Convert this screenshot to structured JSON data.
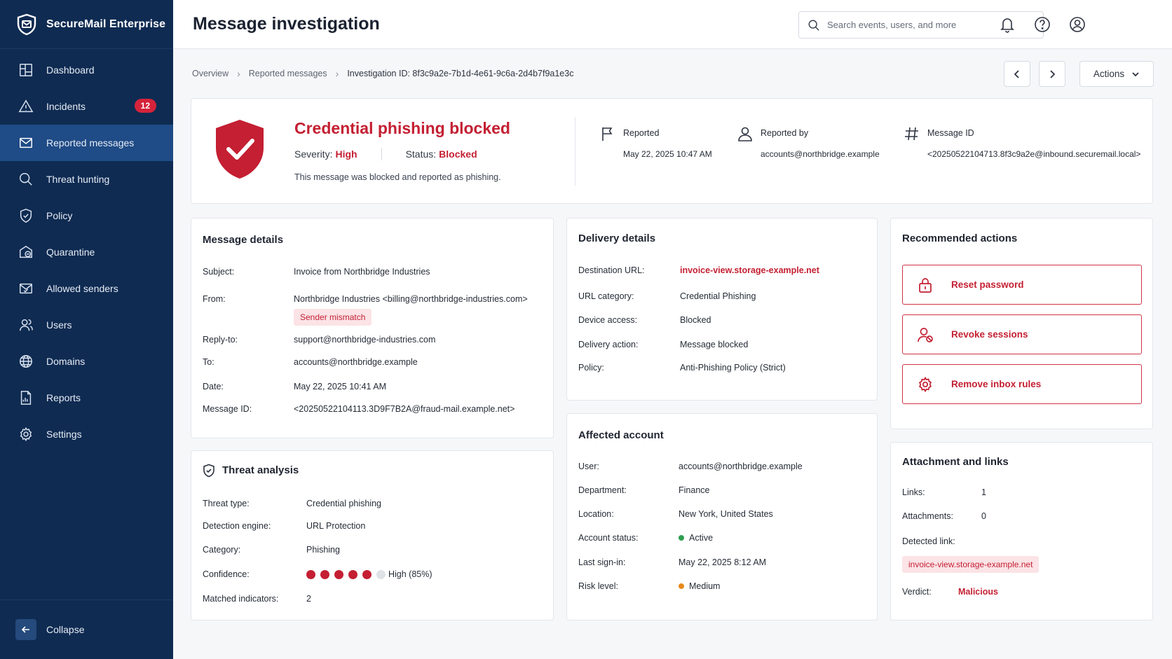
{
  "app": {
    "name": "SecureMail Enterprise"
  },
  "sidebar": {
    "items": [
      {
        "label": "Dashboard",
        "icon": "dashboard-icon"
      },
      {
        "label": "Incidents",
        "icon": "warning-icon",
        "badge": "12"
      },
      {
        "label": "Reported messages",
        "icon": "mail-icon",
        "active": true
      },
      {
        "label": "Threat hunting",
        "icon": "search-icon"
      },
      {
        "label": "Policy",
        "icon": "shield-icon"
      },
      {
        "label": "Quarantine",
        "icon": "quarantine-icon"
      },
      {
        "label": "Allowed senders",
        "icon": "mail-check-icon"
      },
      {
        "label": "Users",
        "icon": "users-icon"
      },
      {
        "label": "Domains",
        "icon": "globe-icon"
      },
      {
        "label": "Reports",
        "icon": "report-icon"
      },
      {
        "label": "Settings",
        "icon": "gear-icon"
      }
    ],
    "collapse_label": "Collapse"
  },
  "header": {
    "title": "Message investigation",
    "search_placeholder": "Search events, users, and more"
  },
  "breadcrumb": {
    "items": [
      "Overview",
      "Reported messages"
    ],
    "current": "Investigation ID: 8f3c9a2e-7b1d-4e61-9c6a-2d4b7f9a1e3c"
  },
  "toolbar": {
    "actions_label": "Actions"
  },
  "summary": {
    "title": "Credential phishing blocked",
    "severity_label": "Severity:",
    "severity": "High",
    "status_label": "Status:",
    "status": "Blocked",
    "description": "This message was blocked and reported as phishing.",
    "reported_label": "Reported",
    "reported_value": "May 22, 2025 10:47 AM",
    "reported_by_label": "Reported by",
    "reported_by_value": "accounts@northbridge.example",
    "message_id_label": "Message ID",
    "message_id_value": "<20250522104713.8f3c9a2e@inbound.securemail.local>"
  },
  "message_details": {
    "title": "Message details",
    "subject_label": "Subject:",
    "subject": "Invoice from Northbridge Industries",
    "from_label": "From:",
    "from": "Northbridge Industries <billing@northbridge-industries.com>",
    "sender_flag": "Sender mismatch",
    "reply_to_label": "Reply-to:",
    "reply_to": "support@northbridge-industries.com",
    "to_label": "To:",
    "to": "accounts@northbridge.example",
    "date_label": "Date:",
    "date": "May 22, 2025 10:41 AM",
    "message_id_label": "Message ID:",
    "message_id": "<20250522104113.3D9F7B2A@fraud-mail.example.net>"
  },
  "threat_analysis": {
    "title": "Threat analysis",
    "threat_type_label": "Threat type:",
    "threat_type": "Credential phishing",
    "engine_label": "Detection engine:",
    "engine": "URL Protection",
    "category_label": "Category:",
    "category": "Phishing",
    "confidence_label": "Confidence:",
    "confidence_filled": 5,
    "confidence_total": 6,
    "confidence_text": "High (85%)",
    "indicators_label": "Matched indicators:",
    "indicators": "2"
  },
  "delivery_details": {
    "title": "Delivery details",
    "dest_url_label": "Destination URL:",
    "dest_url": "invoice-view.storage-example.net",
    "url_category_label": "URL category:",
    "url_category": "Credential Phishing",
    "device_access_label": "Device access:",
    "device_access": "Blocked",
    "delivery_action_label": "Delivery action:",
    "delivery_action": "Message blocked",
    "policy_label": "Policy:",
    "policy": "Anti-Phishing Policy (Strict)"
  },
  "affected_account": {
    "title": "Affected account",
    "user_label": "User:",
    "user": "accounts@northbridge.example",
    "department_label": "Department:",
    "department": "Finance",
    "location_label": "Location:",
    "location": "New York, United States",
    "status_label": "Account status:",
    "status": "Active",
    "last_signin_label": "Last sign-in:",
    "last_signin": "May 22, 2025 8:12 AM",
    "risk_label": "Risk level:",
    "risk": "Medium"
  },
  "recommended_actions": {
    "title": "Recommended actions",
    "actions": [
      {
        "label": "Reset password",
        "icon": "lock-icon"
      },
      {
        "label": "Revoke sessions",
        "icon": "user-revoke-icon"
      },
      {
        "label": "Remove inbox rules",
        "icon": "gear-icon"
      }
    ]
  },
  "attachments": {
    "title": "Attachment and links",
    "links_label": "Links:",
    "links": "1",
    "attachments_label": "Attachments:",
    "attachments": "0",
    "detected_link_label": "Detected link:",
    "detected_link": "invoice-view.storage-example.net",
    "verdict_label": "Verdict:",
    "verdict": "Malicious"
  },
  "colors": {
    "sidebar_bg": "#0f2b52",
    "sidebar_active": "#1f4b86",
    "alert_red": "#c41f32",
    "status_green": "#2e9e4f",
    "risk_orange": "#e8891c"
  }
}
